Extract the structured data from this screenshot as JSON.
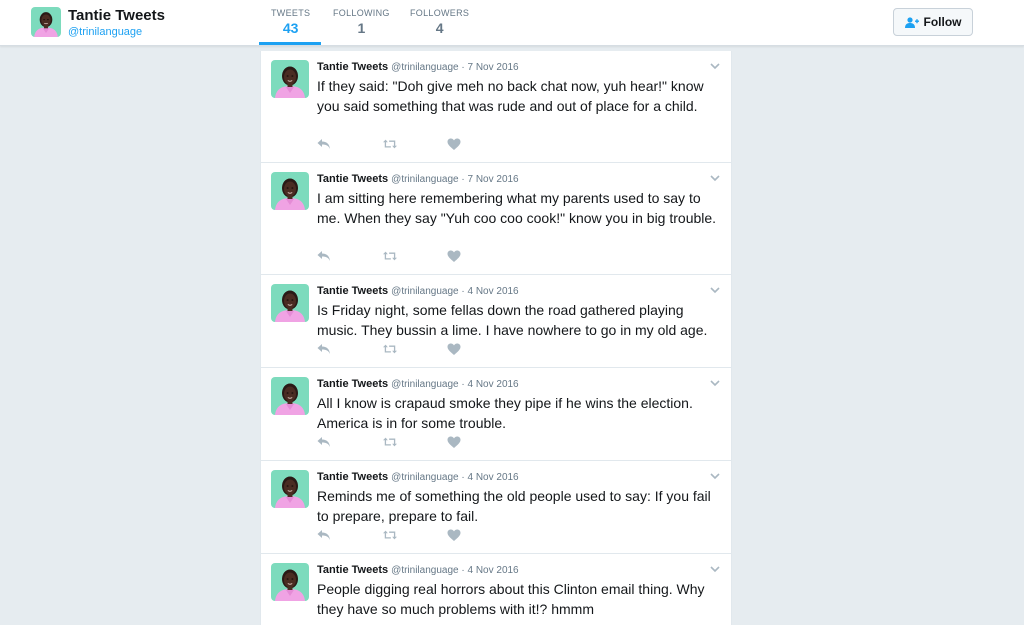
{
  "profile": {
    "name": "Tantie Tweets",
    "handle": "@trinilanguage"
  },
  "stats": [
    {
      "label": "TWEETS",
      "value": "43"
    },
    {
      "label": "FOLLOWING",
      "value": "1"
    },
    {
      "label": "FOLLOWERS",
      "value": "4"
    }
  ],
  "follow": {
    "label": "Follow",
    "icon": "add-user-icon"
  },
  "colors": {
    "accent": "#1da1f2",
    "background": "#e6ecf0",
    "muted": "#657786",
    "icon": "#aab8c2",
    "avatar_bg": "#7ddbbd",
    "avatar_shirt": "#f0a3e4"
  },
  "tweet_icons": [
    "reply-icon",
    "retweet-icon",
    "like-icon",
    "chevron-down-icon"
  ],
  "tweets": [
    {
      "author": "Tantie Tweets",
      "meta": "@trinilanguage · 7 Nov 2016",
      "text": "If they said: \"Doh give meh no back chat now, yuh hear!\" know you said something that was rude and out of place for a child."
    },
    {
      "author": "Tantie Tweets",
      "meta": "@trinilanguage · 7 Nov 2016",
      "text": "I am sitting here remembering what my parents used to say to me. When they say \"Yuh coo coo cook!\" know you in big trouble."
    },
    {
      "author": "Tantie Tweets",
      "meta": "@trinilanguage · 4 Nov 2016",
      "text": "Is Friday night, some fellas down the road gathered playing music. They bussin a lime. I have nowhere to go in my old age."
    },
    {
      "author": "Tantie Tweets",
      "meta": "@trinilanguage · 4 Nov 2016",
      "text": "All I know is crapaud smoke they pipe if he wins the election. America is in for some trouble."
    },
    {
      "author": "Tantie Tweets",
      "meta": "@trinilanguage · 4 Nov 2016",
      "text": "Reminds me of something the old people used to say: If you fail to prepare, prepare to fail."
    },
    {
      "author": "Tantie Tweets",
      "meta": "@trinilanguage · 4 Nov 2016",
      "text": "People digging real horrors about this Clinton email thing. Why they have so much problems with it!? hmmm"
    }
  ]
}
